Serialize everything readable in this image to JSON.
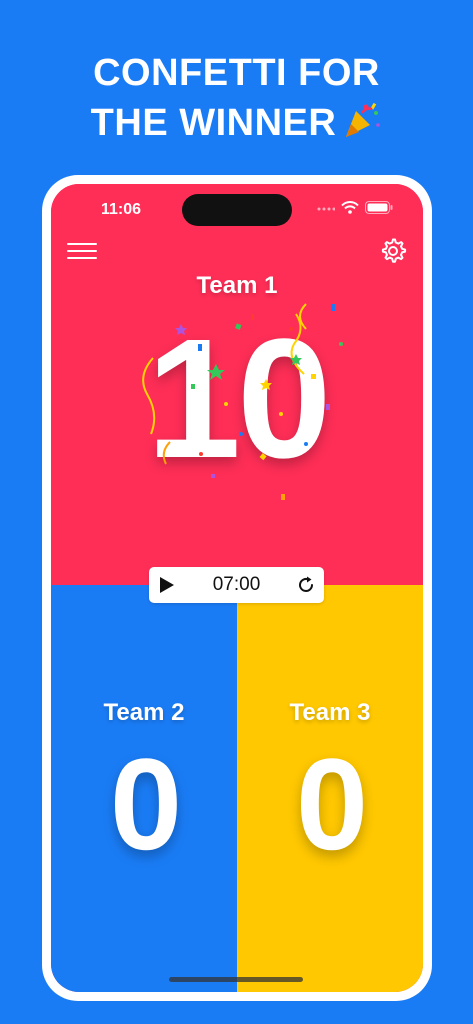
{
  "headline": {
    "line1": "CONFETTI FOR",
    "line2": "THE WINNER"
  },
  "status_bar": {
    "time": "11:06"
  },
  "teams": [
    {
      "name": "Team 1",
      "score": "10",
      "color": "#ff2e57"
    },
    {
      "name": "Team 2",
      "score": "0",
      "color": "#1a7cf5"
    },
    {
      "name": "Team 3",
      "score": "0",
      "color": "#ffc800"
    }
  ],
  "timer": {
    "time": "07:00"
  },
  "icons": {
    "menu": "hamburger-menu-icon",
    "settings": "gear-icon",
    "play": "play-icon",
    "reset": "reset-icon",
    "party": "party-popper-icon"
  },
  "colors": {
    "background": "#1a7cf5",
    "accent_red": "#ff2e57",
    "accent_blue": "#1a7cf5",
    "accent_yellow": "#ffc800"
  }
}
